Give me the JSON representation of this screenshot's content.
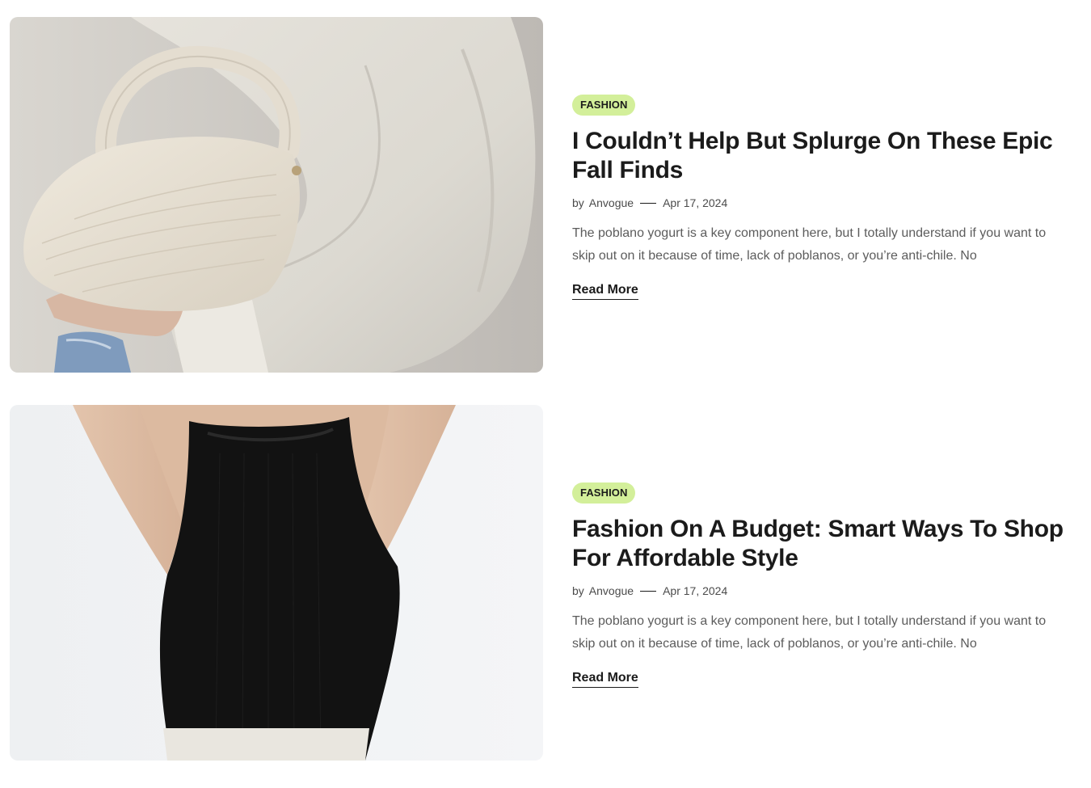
{
  "posts": [
    {
      "category": "FASHION",
      "title": "I Couldn’t Help But Splurge On These Epic Fall Finds",
      "by": "by",
      "author": "Anvogue",
      "date": "Apr 17, 2024",
      "excerpt": "The poblano yogurt is a key component here, but I totally understand if you want to skip out on it because of time, lack of poblanos, or you’re anti-chile. No",
      "read_more": "Read More",
      "image": "cream-knotted-handbag-photo"
    },
    {
      "category": "FASHION",
      "title": "Fashion On A Budget: Smart Ways To Shop For Affordable Style",
      "by": "by",
      "author": "Anvogue",
      "date": "Apr 17, 2024",
      "excerpt": "The poblano yogurt is a key component here, but I totally understand if you want to skip out on it because of time, lack of poblanos, or you’re anti-chile. No",
      "read_more": "Read More",
      "image": "black-tank-top-photo"
    }
  ],
  "colors": {
    "tag_background": "#d3ef9a",
    "text_primary": "#1b1b1b",
    "text_secondary": "#5c5c5c"
  }
}
